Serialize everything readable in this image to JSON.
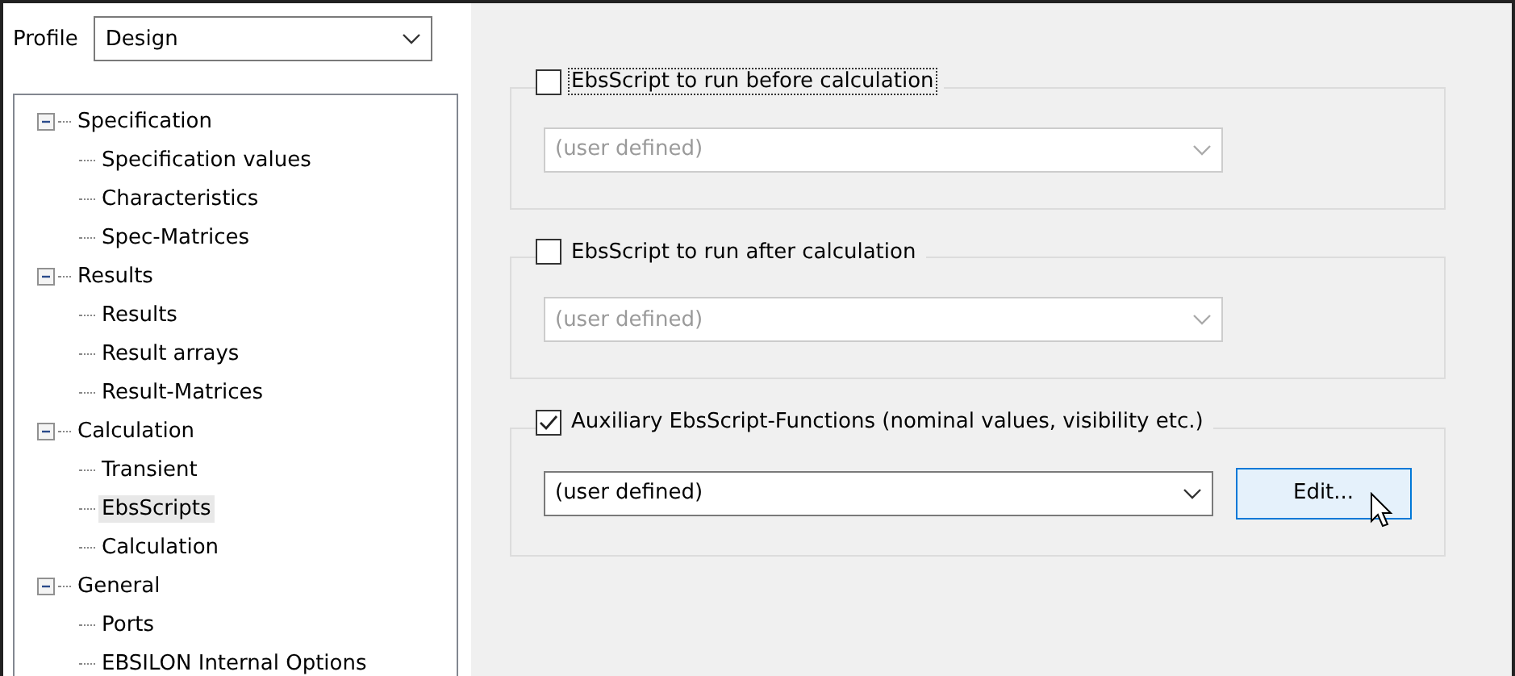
{
  "profile": {
    "label": "Profile",
    "value": "Design"
  },
  "tree": [
    {
      "label": "Specification",
      "expanded": true,
      "selected": false,
      "children": [
        {
          "label": "Specification values",
          "selected": false
        },
        {
          "label": "Characteristics",
          "selected": false
        },
        {
          "label": "Spec-Matrices",
          "selected": false
        }
      ]
    },
    {
      "label": "Results",
      "expanded": true,
      "selected": false,
      "children": [
        {
          "label": "Results",
          "selected": false
        },
        {
          "label": "Result arrays",
          "selected": false
        },
        {
          "label": "Result-Matrices",
          "selected": false
        }
      ]
    },
    {
      "label": "Calculation",
      "expanded": true,
      "selected": false,
      "children": [
        {
          "label": "Transient",
          "selected": false
        },
        {
          "label": "EbsScripts",
          "selected": true
        },
        {
          "label": "Calculation",
          "selected": false
        }
      ]
    },
    {
      "label": "General",
      "expanded": true,
      "selected": false,
      "children": [
        {
          "label": "Ports",
          "selected": false
        },
        {
          "label": "EBSILON Internal Options",
          "selected": false
        }
      ]
    }
  ],
  "groups": [
    {
      "label": "EbsScript to run before calculation",
      "checked": false,
      "focused": true,
      "combo": {
        "value": "(user defined)",
        "disabled": true
      }
    },
    {
      "label": "EbsScript to run after calculation",
      "checked": false,
      "focused": false,
      "combo": {
        "value": "(user defined)",
        "disabled": true
      }
    },
    {
      "label": "Auxiliary EbsScript-Functions (nominal values, visibility etc.)",
      "checked": true,
      "focused": false,
      "combo": {
        "value": "(user defined)",
        "disabled": false
      },
      "button": {
        "label": "Edit...",
        "hovered": true
      }
    }
  ]
}
